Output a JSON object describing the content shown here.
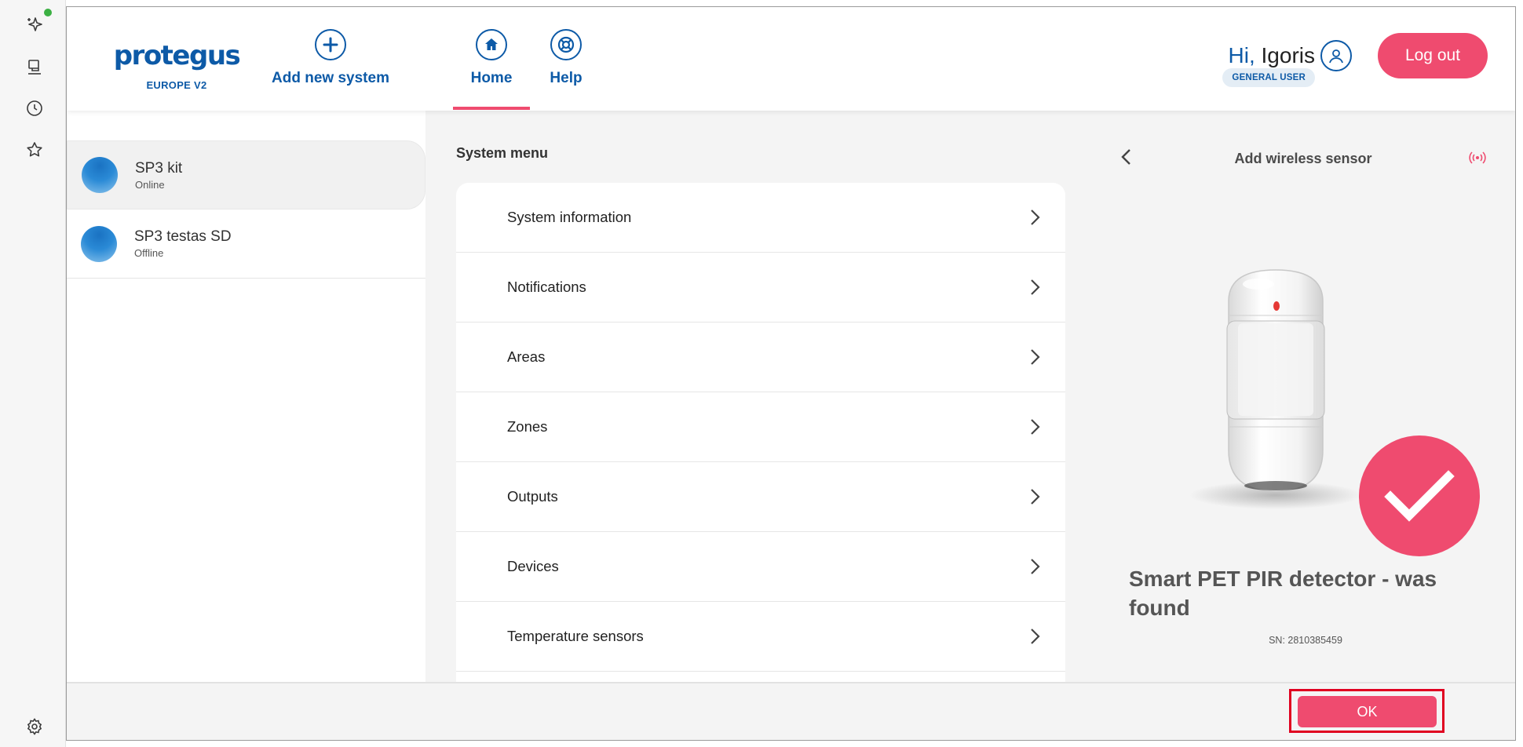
{
  "dock": {
    "items": [
      "sparkle-icon",
      "computer-use-icon",
      "history-icon",
      "star-icon",
      "settings-icon"
    ],
    "status_dot_color": "#3cb043"
  },
  "header": {
    "logo_text": "protegus",
    "region": "EUROPE V2",
    "add_system_label": "Add new system",
    "home_label": "Home",
    "help_label": "Help",
    "greeting_hi": "Hi,",
    "user_name": "Igoris",
    "role": "GENERAL USER",
    "logout_label": "Log out"
  },
  "systems": [
    {
      "name": "SP3 kit",
      "status": "Online"
    },
    {
      "name": "SP3 testas SD",
      "status": "Offline"
    }
  ],
  "system_menu": {
    "title": "System menu",
    "items": [
      {
        "label": "System information"
      },
      {
        "label": "Notifications"
      },
      {
        "label": "Areas"
      },
      {
        "label": "Zones"
      },
      {
        "label": "Outputs"
      },
      {
        "label": "Devices"
      },
      {
        "label": "Temperature sensors"
      }
    ]
  },
  "sensor_panel": {
    "title": "Add wireless sensor",
    "found_text": "Smart PET PIR detector - was found",
    "serial": "SN: 2810385459"
  },
  "footer": {
    "ok_label": "OK"
  },
  "colors": {
    "brand_blue": "#0d5aa7",
    "accent_pink": "#ef4b6f",
    "highlight_red": "#e00020"
  }
}
